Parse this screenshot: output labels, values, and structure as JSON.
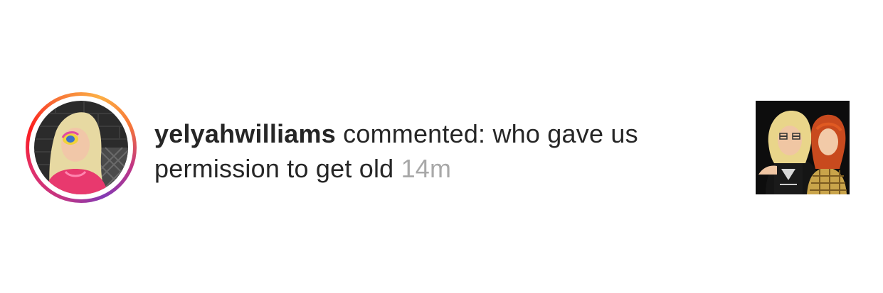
{
  "notification": {
    "username": "yelyahwilliams",
    "action": " commented: ",
    "comment": "who gave us permission to get old",
    "timestamp": "14m"
  },
  "avatar": {
    "ring_colors": [
      "#c13584",
      "#e1306c",
      "#fd1d1d",
      "#f77737",
      "#fcaf45",
      "#833ab4"
    ]
  },
  "colors": {
    "text": "#262626",
    "timestamp": "#a8a8a8"
  }
}
